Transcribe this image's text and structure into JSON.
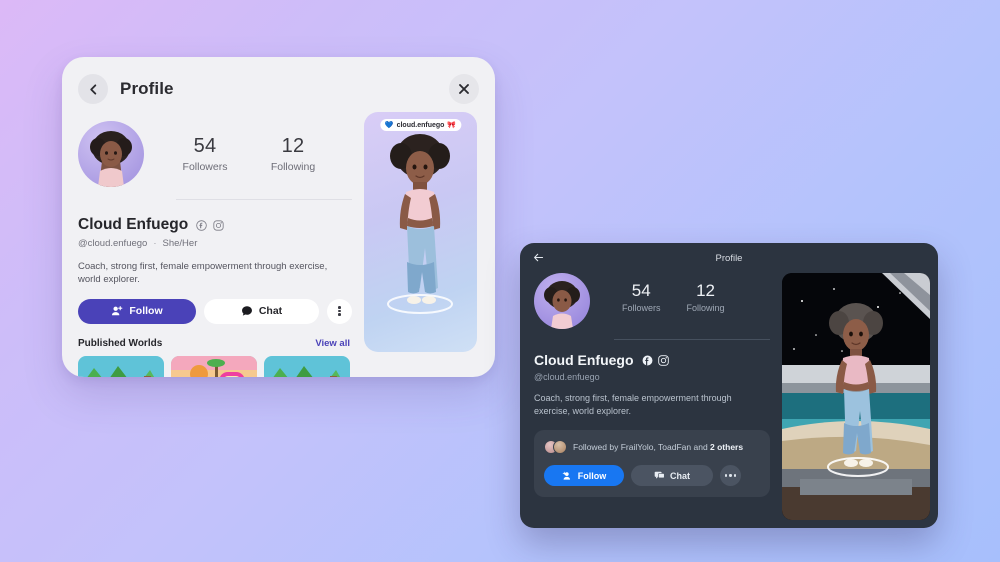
{
  "light_card": {
    "header": {
      "back_icon": "chevron-left-icon",
      "title": "Profile",
      "close_icon": "close-icon"
    },
    "stats": [
      {
        "value": "54",
        "label": "Followers"
      },
      {
        "value": "12",
        "label": "Following"
      }
    ],
    "profile": {
      "name": "Cloud Enfuego",
      "handle": "@cloud.enfuego",
      "separator": "·",
      "pronouns": "She/Her",
      "bio": "Coach, strong first, female empowerment through exercise, world explorer.",
      "social_icons": [
        "facebook-icon",
        "instagram-icon"
      ]
    },
    "actions": {
      "follow_label": "Follow",
      "follow_icon": "add-person-icon",
      "chat_label": "Chat",
      "chat_icon": "chat-bubble-icon",
      "more_icon": "kebab-menu-icon"
    },
    "worlds": {
      "title": "Published Worlds",
      "view_all": "View all",
      "items": [
        {
          "name": "jungle-world-thumbnail"
        },
        {
          "name": "beach-world-thumbnail"
        },
        {
          "name": "jungle-world-thumbnail-2"
        }
      ]
    },
    "avatar_preview": {
      "nametag_text": "cloud.enfuego",
      "nametag_left_emoji": "💙",
      "nametag_right_emoji": "🎀"
    },
    "colors": {
      "card_bg": "#f1f1f4",
      "accent": "#4a42b8",
      "title_text": "#2b2b30"
    }
  },
  "dark_card": {
    "header": {
      "back_icon": "arrow-left-icon",
      "title": "Profile"
    },
    "stats": [
      {
        "value": "54",
        "label": "Followers"
      },
      {
        "value": "12",
        "label": "Following"
      }
    ],
    "profile": {
      "name": "Cloud Enfuego",
      "handle": "@cloud.enfuego",
      "bio": "Coach, strong first, female empowerment through exercise, world explorer.",
      "social_icons": [
        "facebook-icon",
        "instagram-icon"
      ]
    },
    "followed_by": {
      "prefix": "Followed by FrailYolo, ToadFan and ",
      "emphasis": "2 others"
    },
    "actions": {
      "follow_label": "Follow",
      "follow_icon": "add-person-icon",
      "chat_label": "Chat",
      "chat_icon": "chat-bubble-icon",
      "more_icon": "ellipsis-icon"
    },
    "colors": {
      "card_bg": "#2c3440",
      "panel_bg": "#39414d",
      "accent": "#1877f2"
    }
  },
  "background": {
    "gradient_from": "#dcb9f7",
    "gradient_to": "#a7bffc"
  }
}
